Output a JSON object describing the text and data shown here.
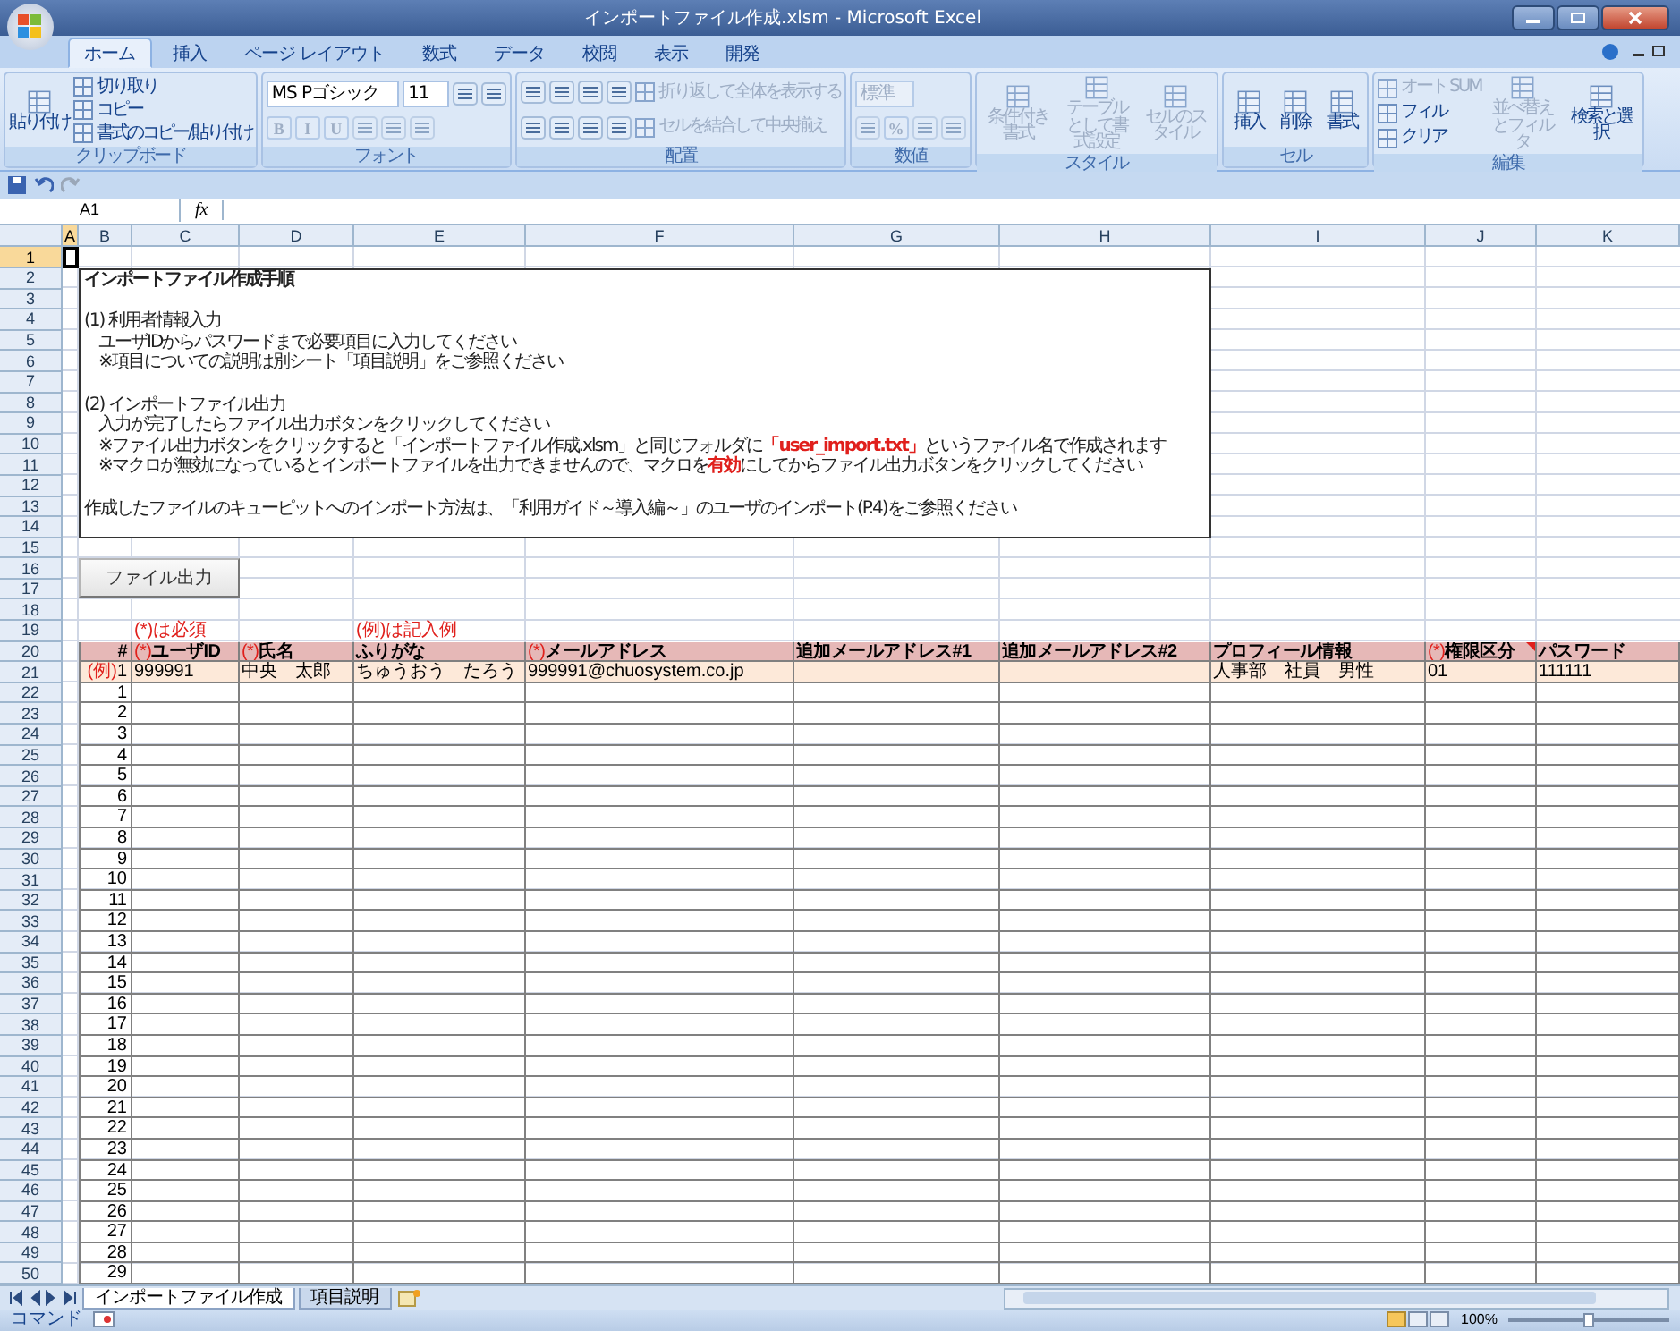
{
  "window": {
    "title": "インポートファイル作成.xlsm - Microsoft Excel"
  },
  "ribbon_tabs": [
    {
      "label": "ホーム",
      "selected": true
    },
    {
      "label": "挿入",
      "selected": false
    },
    {
      "label": "ページ レイアウト",
      "selected": false
    },
    {
      "label": "数式",
      "selected": false
    },
    {
      "label": "データ",
      "selected": false
    },
    {
      "label": "校閲",
      "selected": false
    },
    {
      "label": "表示",
      "selected": false
    },
    {
      "label": "開発",
      "selected": false
    }
  ],
  "ribbon_groups": [
    {
      "label": "クリップボード",
      "columns": [
        [
          {
            "kind": "large",
            "label": "貼り付け",
            "disabled": false
          }
        ],
        [
          {
            "kind": "small",
            "label": "切り取り",
            "disabled": false
          },
          {
            "kind": "small",
            "label": "コピー",
            "disabled": false
          },
          {
            "kind": "small",
            "label": "書式のコピー/貼り付け",
            "disabled": false
          }
        ]
      ]
    },
    {
      "label": "フォント",
      "columns": [
        [
          {
            "kind": "row",
            "items": [
              {
                "kind": "combo",
                "value": "MS Pゴシック",
                "disabled": false
              },
              {
                "kind": "combo",
                "value": "11",
                "disabled": false
              },
              {
                "kind": "icon_button",
                "disabled": false
              },
              {
                "kind": "icon_button",
                "disabled": false
              }
            ]
          },
          {
            "kind": "row",
            "items": [
              {
                "kind": "glyph",
                "label": "B",
                "disabled": true
              },
              {
                "kind": "glyph",
                "label": "I",
                "disabled": true
              },
              {
                "kind": "glyph",
                "label": "U",
                "disabled": true
              },
              {
                "kind": "icon_button",
                "disabled": true
              },
              {
                "kind": "icon_button",
                "disabled": true
              },
              {
                "kind": "icon_button",
                "disabled": true
              }
            ]
          }
        ]
      ]
    },
    {
      "label": "配置",
      "columns": [
        [
          {
            "kind": "row",
            "items": [
              {
                "kind": "icon_button",
                "disabled": false
              },
              {
                "kind": "icon_button",
                "disabled": false
              },
              {
                "kind": "icon_button",
                "disabled": false
              },
              {
                "kind": "icon_button",
                "disabled": false
              }
            ]
          },
          {
            "kind": "row",
            "items": [
              {
                "kind": "icon_button",
                "disabled": false
              },
              {
                "kind": "icon_button",
                "disabled": false
              },
              {
                "kind": "icon_button",
                "disabled": false
              },
              {
                "kind": "icon_button",
                "disabled": false
              }
            ]
          }
        ],
        [
          {
            "kind": "small",
            "label": "折り返して全体を表示する",
            "disabled": true
          },
          {
            "kind": "small",
            "label": "セルを結合して中央揃え",
            "disabled": true
          }
        ]
      ]
    },
    {
      "label": "数値",
      "columns": [
        [
          {
            "kind": "row",
            "items": [
              {
                "kind": "combo",
                "value": "標準",
                "disabled": true
              }
            ]
          },
          {
            "kind": "row",
            "items": [
              {
                "kind": "icon_button",
                "disabled": true
              },
              {
                "kind": "glyph",
                "label": "%",
                "disabled": true
              },
              {
                "kind": "icon_button",
                "disabled": true
              },
              {
                "kind": "icon_button",
                "disabled": true
              }
            ]
          }
        ]
      ]
    },
    {
      "label": "スタイル",
      "columns": [
        [
          {
            "kind": "large",
            "label": "条件付き書式",
            "disabled": true
          }
        ],
        [
          {
            "kind": "large",
            "label": "テーブルとして書式設定",
            "disabled": true
          }
        ],
        [
          {
            "kind": "large",
            "label": "セルのスタイル",
            "disabled": true
          }
        ]
      ]
    },
    {
      "label": "セル",
      "columns": [
        [
          {
            "kind": "large",
            "label": "挿入",
            "disabled": false
          }
        ],
        [
          {
            "kind": "large",
            "label": "削除",
            "disabled": false
          }
        ],
        [
          {
            "kind": "large",
            "label": "書式",
            "disabled": false
          }
        ]
      ]
    },
    {
      "label": "編集",
      "columns": [
        [
          {
            "kind": "small",
            "label": "オート SUM",
            "disabled": true
          },
          {
            "kind": "small",
            "label": "フィル",
            "disabled": false
          },
          {
            "kind": "small",
            "label": "クリア",
            "disabled": false
          }
        ],
        [
          {
            "kind": "large",
            "label": "並べ替えとフィルタ",
            "disabled": true
          }
        ],
        [
          {
            "kind": "large",
            "label": "検索と選択",
            "disabled": false
          }
        ]
      ]
    }
  ],
  "formula_bar": {
    "name_box": "A1",
    "function_label": "fx"
  },
  "column_headers": [
    {
      "label": "A",
      "selected": true
    },
    {
      "label": "B",
      "selected": false
    },
    {
      "label": "C",
      "selected": false
    },
    {
      "label": "D",
      "selected": false
    },
    {
      "label": "E",
      "selected": false
    },
    {
      "label": "F",
      "selected": false
    },
    {
      "label": "G",
      "selected": false
    },
    {
      "label": "H",
      "selected": false
    },
    {
      "label": "I",
      "selected": false
    },
    {
      "label": "J",
      "selected": false
    },
    {
      "label": "K",
      "selected": false
    }
  ],
  "row_headers": [
    {
      "label": "1",
      "selected": true
    },
    {
      "label": "2",
      "selected": false
    },
    {
      "label": "3",
      "selected": false
    },
    {
      "label": "4",
      "selected": false
    },
    {
      "label": "5",
      "selected": false
    },
    {
      "label": "6",
      "selected": false
    },
    {
      "label": "7",
      "selected": false
    },
    {
      "label": "8",
      "selected": false
    },
    {
      "label": "9",
      "selected": false
    },
    {
      "label": "10",
      "selected": false
    },
    {
      "label": "11",
      "selected": false
    },
    {
      "label": "12",
      "selected": false
    },
    {
      "label": "13",
      "selected": false
    },
    {
      "label": "14",
      "selected": false
    },
    {
      "label": "15",
      "selected": false
    },
    {
      "label": "16",
      "selected": false
    },
    {
      "label": "17",
      "selected": false
    },
    {
      "label": "18",
      "selected": false
    },
    {
      "label": "19",
      "selected": false
    },
    {
      "label": "20",
      "selected": false
    },
    {
      "label": "21",
      "selected": false
    },
    {
      "label": "22",
      "selected": false
    },
    {
      "label": "23",
      "selected": false
    },
    {
      "label": "24",
      "selected": false
    },
    {
      "label": "25",
      "selected": false
    },
    {
      "label": "26",
      "selected": false
    },
    {
      "label": "27",
      "selected": false
    },
    {
      "label": "28",
      "selected": false
    },
    {
      "label": "29",
      "selected": false
    },
    {
      "label": "30",
      "selected": false
    },
    {
      "label": "31",
      "selected": false
    },
    {
      "label": "32",
      "selected": false
    },
    {
      "label": "33",
      "selected": false
    },
    {
      "label": "34",
      "selected": false
    },
    {
      "label": "35",
      "selected": false
    },
    {
      "label": "36",
      "selected": false
    },
    {
      "label": "37",
      "selected": false
    },
    {
      "label": "38",
      "selected": false
    },
    {
      "label": "39",
      "selected": false
    },
    {
      "label": "40",
      "selected": false
    },
    {
      "label": "41",
      "selected": false
    },
    {
      "label": "42",
      "selected": false
    },
    {
      "label": "43",
      "selected": false
    },
    {
      "label": "44",
      "selected": false
    },
    {
      "label": "45",
      "selected": false
    },
    {
      "label": "46",
      "selected": false
    },
    {
      "label": "47",
      "selected": false
    },
    {
      "label": "48",
      "selected": false
    },
    {
      "label": "49",
      "selected": false
    },
    {
      "label": "50",
      "selected": false
    }
  ],
  "instructions": {
    "title": "インポートファイル作成手順",
    "sections": [
      {
        "heading": "(1) 利用者情報入力",
        "lines": [
          [
            {
              "text": "ユーザIDからパスワードまで必要項目に入力してください",
              "highlight": false
            }
          ],
          [
            {
              "text": "※項目についての説明は別シート「項目説明」をご参照ください",
              "highlight": false
            }
          ]
        ]
      },
      {
        "heading": "(2) インポートファイル出力",
        "lines": [
          [
            {
              "text": "入力が完了したらファイル出力ボタンをクリックしてください",
              "highlight": false
            }
          ],
          [
            {
              "text": "※ファイル出力ボタンをクリックすると「インポートファイル作成.xlsm」と同じフォルダに",
              "highlight": false
            },
            {
              "text": "「user_import.txt」",
              "highlight": true
            },
            {
              "text": "というファイル名で作成されます",
              "highlight": false
            }
          ],
          [
            {
              "text": "※マクロが無効になっているとインポートファイルを出力できませんので、マクロを",
              "highlight": false
            },
            {
              "text": "有効",
              "highlight": true
            },
            {
              "text": "にしてからファイル出力ボタンをクリックしてください",
              "highlight": false
            }
          ]
        ]
      }
    ],
    "footer": "作成したファイルのキューピットへのインポート方法は、「利用ガイド～導入編～」のユーザのインポート(P.4)をご参照ください"
  },
  "export_button": {
    "label": "ファイル出力"
  },
  "notes": [
    {
      "text": "(*)は必須"
    },
    {
      "text": "(例)は記入例"
    }
  ],
  "table": {
    "columns": [
      {
        "label": "#",
        "comment": false
      },
      {
        "mark": "(*)",
        "label": "ユーザID",
        "comment": false
      },
      {
        "mark": "(*)",
        "label": "氏名",
        "comment": false
      },
      {
        "label": "ふりがな",
        "comment": false
      },
      {
        "mark": "(*)",
        "label": "メールアドレス",
        "comment": false
      },
      {
        "label": "追加メールアドレス#1",
        "comment": false
      },
      {
        "label": "追加メールアドレス#2",
        "comment": false
      },
      {
        "label": "プロフィール情報",
        "comment": false
      },
      {
        "mark": "(*)",
        "label": "権限区分",
        "comment": true
      },
      {
        "label": "パスワード",
        "comment": false
      }
    ],
    "example_row": {
      "prefix": "(例)",
      "number": "1",
      "cells": [
        "999991",
        "中央　太郎",
        "ちゅうおう　たろう",
        "999991@chuosystem.co.jp",
        null,
        null,
        "人事部　社員　男性",
        "01",
        "111111"
      ]
    },
    "rows": [
      "1",
      "2",
      "3",
      "4",
      "5",
      "6",
      "7",
      "8",
      "9",
      "10",
      "11",
      "12",
      "13",
      "14",
      "15",
      "16",
      "17",
      "18",
      "19",
      "20",
      "21",
      "22",
      "23",
      "24",
      "25",
      "26",
      "27",
      "28",
      "29"
    ]
  },
  "sheet_tabs": [
    {
      "label": "インポートファイル作成",
      "selected": true
    },
    {
      "label": "項目説明",
      "selected": false
    }
  ],
  "status_bar": {
    "mode": "コマンド",
    "zoom": {
      "reading": "100%",
      "level": 0.5
    }
  }
}
